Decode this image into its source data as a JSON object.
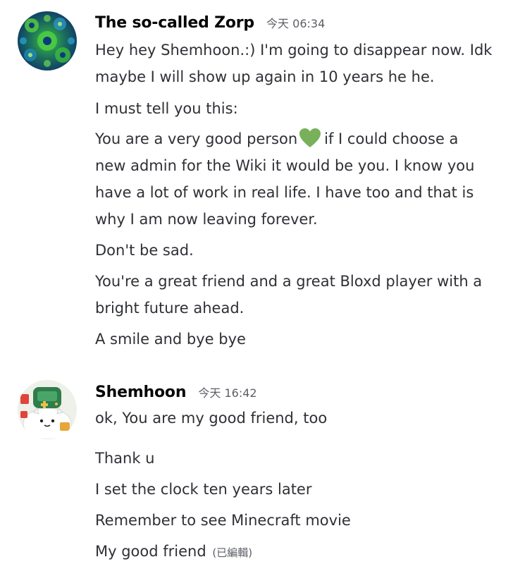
{
  "messages": [
    {
      "author": "The so-called Zorp",
      "timestamp": "今天 06:34",
      "avatar_icon": "fractal-green-avatar",
      "paragraphs": [
        [
          "Hey hey Shemhoon.:) I'm going to disappear now. Idk",
          "maybe I will show up again in 10 years he he."
        ],
        [
          "I must tell you this:"
        ],
        [
          "You are a very good person",
          "if I could choose a",
          "new admin for the Wiki it would be you.  I know you",
          "have a lot of work in real life. I have too and that is",
          "why I am now leaving forever."
        ],
        [
          "Don't be sad."
        ],
        [
          "You're a great friend and a great Bloxd player with a",
          "bright future ahead."
        ],
        [
          "A smile and bye bye"
        ]
      ],
      "emoji": "green-heart-icon"
    },
    {
      "author": "Shemhoon",
      "timestamp": "今天 16:42",
      "avatar_icon": "cat-gamepad-avatar",
      "lines": [
        "ok, You are my good friend, too",
        "Thank u",
        "I set the clock ten years later",
        "Remember to see Minecraft movie",
        "My good friend"
      ],
      "edited_label": "(已編輯)"
    }
  ],
  "colors": {
    "username": "#060607",
    "text": "#2e3035",
    "muted": "#5c5e66",
    "heart": "#78b159",
    "background": "#ffffff"
  }
}
